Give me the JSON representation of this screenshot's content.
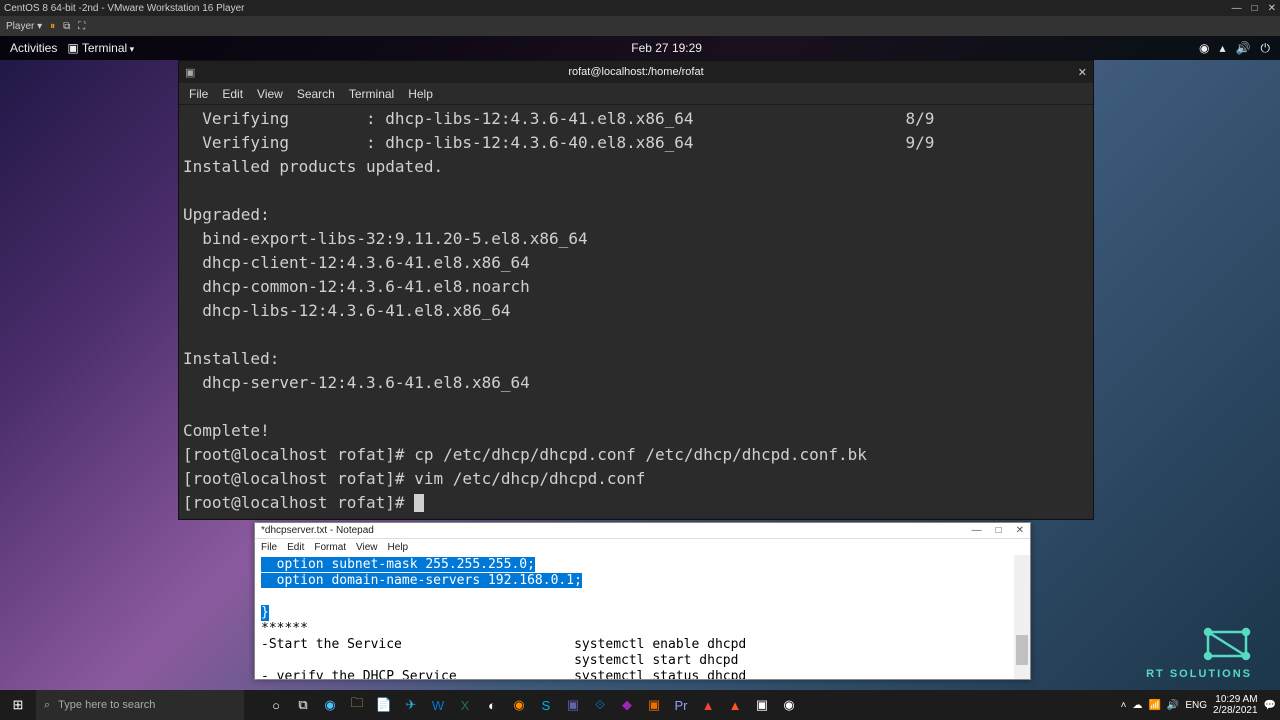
{
  "vmware": {
    "title": "CentOS 8 64-bit -2nd - VMware Workstation 16 Player",
    "player": "Player ▾"
  },
  "gnome": {
    "activities": "Activities",
    "appmenu": "Terminal",
    "clock": "Feb 27  19:29"
  },
  "terminal": {
    "title": "rofat@localhost:/home/rofat",
    "menu": [
      "File",
      "Edit",
      "View",
      "Search",
      "Terminal",
      "Help"
    ],
    "lines": [
      "  Verifying        : dhcp-libs-12:4.3.6-41.el8.x86_64                      8/9",
      "  Verifying        : dhcp-libs-12:4.3.6-40.el8.x86_64                      9/9",
      "Installed products updated.",
      "",
      "Upgraded:",
      "  bind-export-libs-32:9.11.20-5.el8.x86_64",
      "  dhcp-client-12:4.3.6-41.el8.x86_64",
      "  dhcp-common-12:4.3.6-41.el8.noarch",
      "  dhcp-libs-12:4.3.6-41.el8.x86_64",
      "",
      "Installed:",
      "  dhcp-server-12:4.3.6-41.el8.x86_64",
      "",
      "Complete!",
      "[root@localhost rofat]# cp /etc/dhcp/dhcpd.conf /etc/dhcp/dhcpd.conf.bk",
      "[root@localhost rofat]# vim /etc/dhcp/dhcpd.conf",
      "[root@localhost rofat]# "
    ]
  },
  "notepad": {
    "title": "*dhcpserver.txt - Notepad",
    "menu": [
      "File",
      "Edit",
      "Format",
      "View",
      "Help"
    ],
    "sel1": "  option subnet-mask 255.255.255.0;",
    "sel2": "  option domain-name-servers 192.168.0.1;",
    "bracket": "}",
    "stars": "******",
    "line_start": "-Start the Service                      systemctl enable dhcpd",
    "line_start2": "                                        systemctl start dhcpd",
    "line_verify": "- verify the DHCP Service               systemctl status dhcpd"
  },
  "taskbar": {
    "search_placeholder": "Type here to search",
    "lang": "ENG",
    "time": "10:29 AM",
    "date": "2/28/2021"
  },
  "logo": "RT SOLUTIONS"
}
